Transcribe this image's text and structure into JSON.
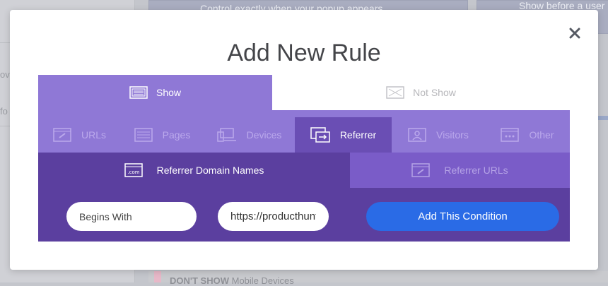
{
  "background": {
    "top_card_left_text": "Control exactly when your popup appears",
    "top_card_right_text": "Show before a user",
    "left_fragments": [
      "ov",
      "fo"
    ],
    "bottom_label_bold": "DON'T SHOW",
    "bottom_label": "Mobile Devices"
  },
  "modal": {
    "title": "Add New Rule",
    "close_icon": "close-icon"
  },
  "show_tabs": [
    {
      "label": "Show",
      "icon": "show-icon",
      "active": true
    },
    {
      "label": "Not Show",
      "icon": "not-show-icon",
      "active": false
    }
  ],
  "type_tabs": [
    {
      "label": "URLs",
      "icon": "link-icon"
    },
    {
      "label": "Pages",
      "icon": "pages-icon"
    },
    {
      "label": "Devices",
      "icon": "devices-icon"
    },
    {
      "label": "Referrer",
      "icon": "referrer-icon",
      "active": true
    },
    {
      "label": "Visitors",
      "icon": "visitors-icon"
    },
    {
      "label": "Other",
      "icon": "other-icon"
    }
  ],
  "sub_tabs": [
    {
      "label": "Referrer Domain Names",
      "icon": "domain-icon",
      "active": true
    },
    {
      "label": "Referrer URLs",
      "icon": "referrer-url-icon",
      "active": false
    }
  ],
  "form": {
    "match_select": "Begins With",
    "domain_value": "https://producthunt.com",
    "add_button": "Add This Condition"
  },
  "colors": {
    "tab_purple": "#8f78d6",
    "active_type_tab": "#6a4eb4",
    "sub_row": "#7a5cc8",
    "form_row": "#5b3f9f",
    "button_blue": "#2a6be6"
  }
}
